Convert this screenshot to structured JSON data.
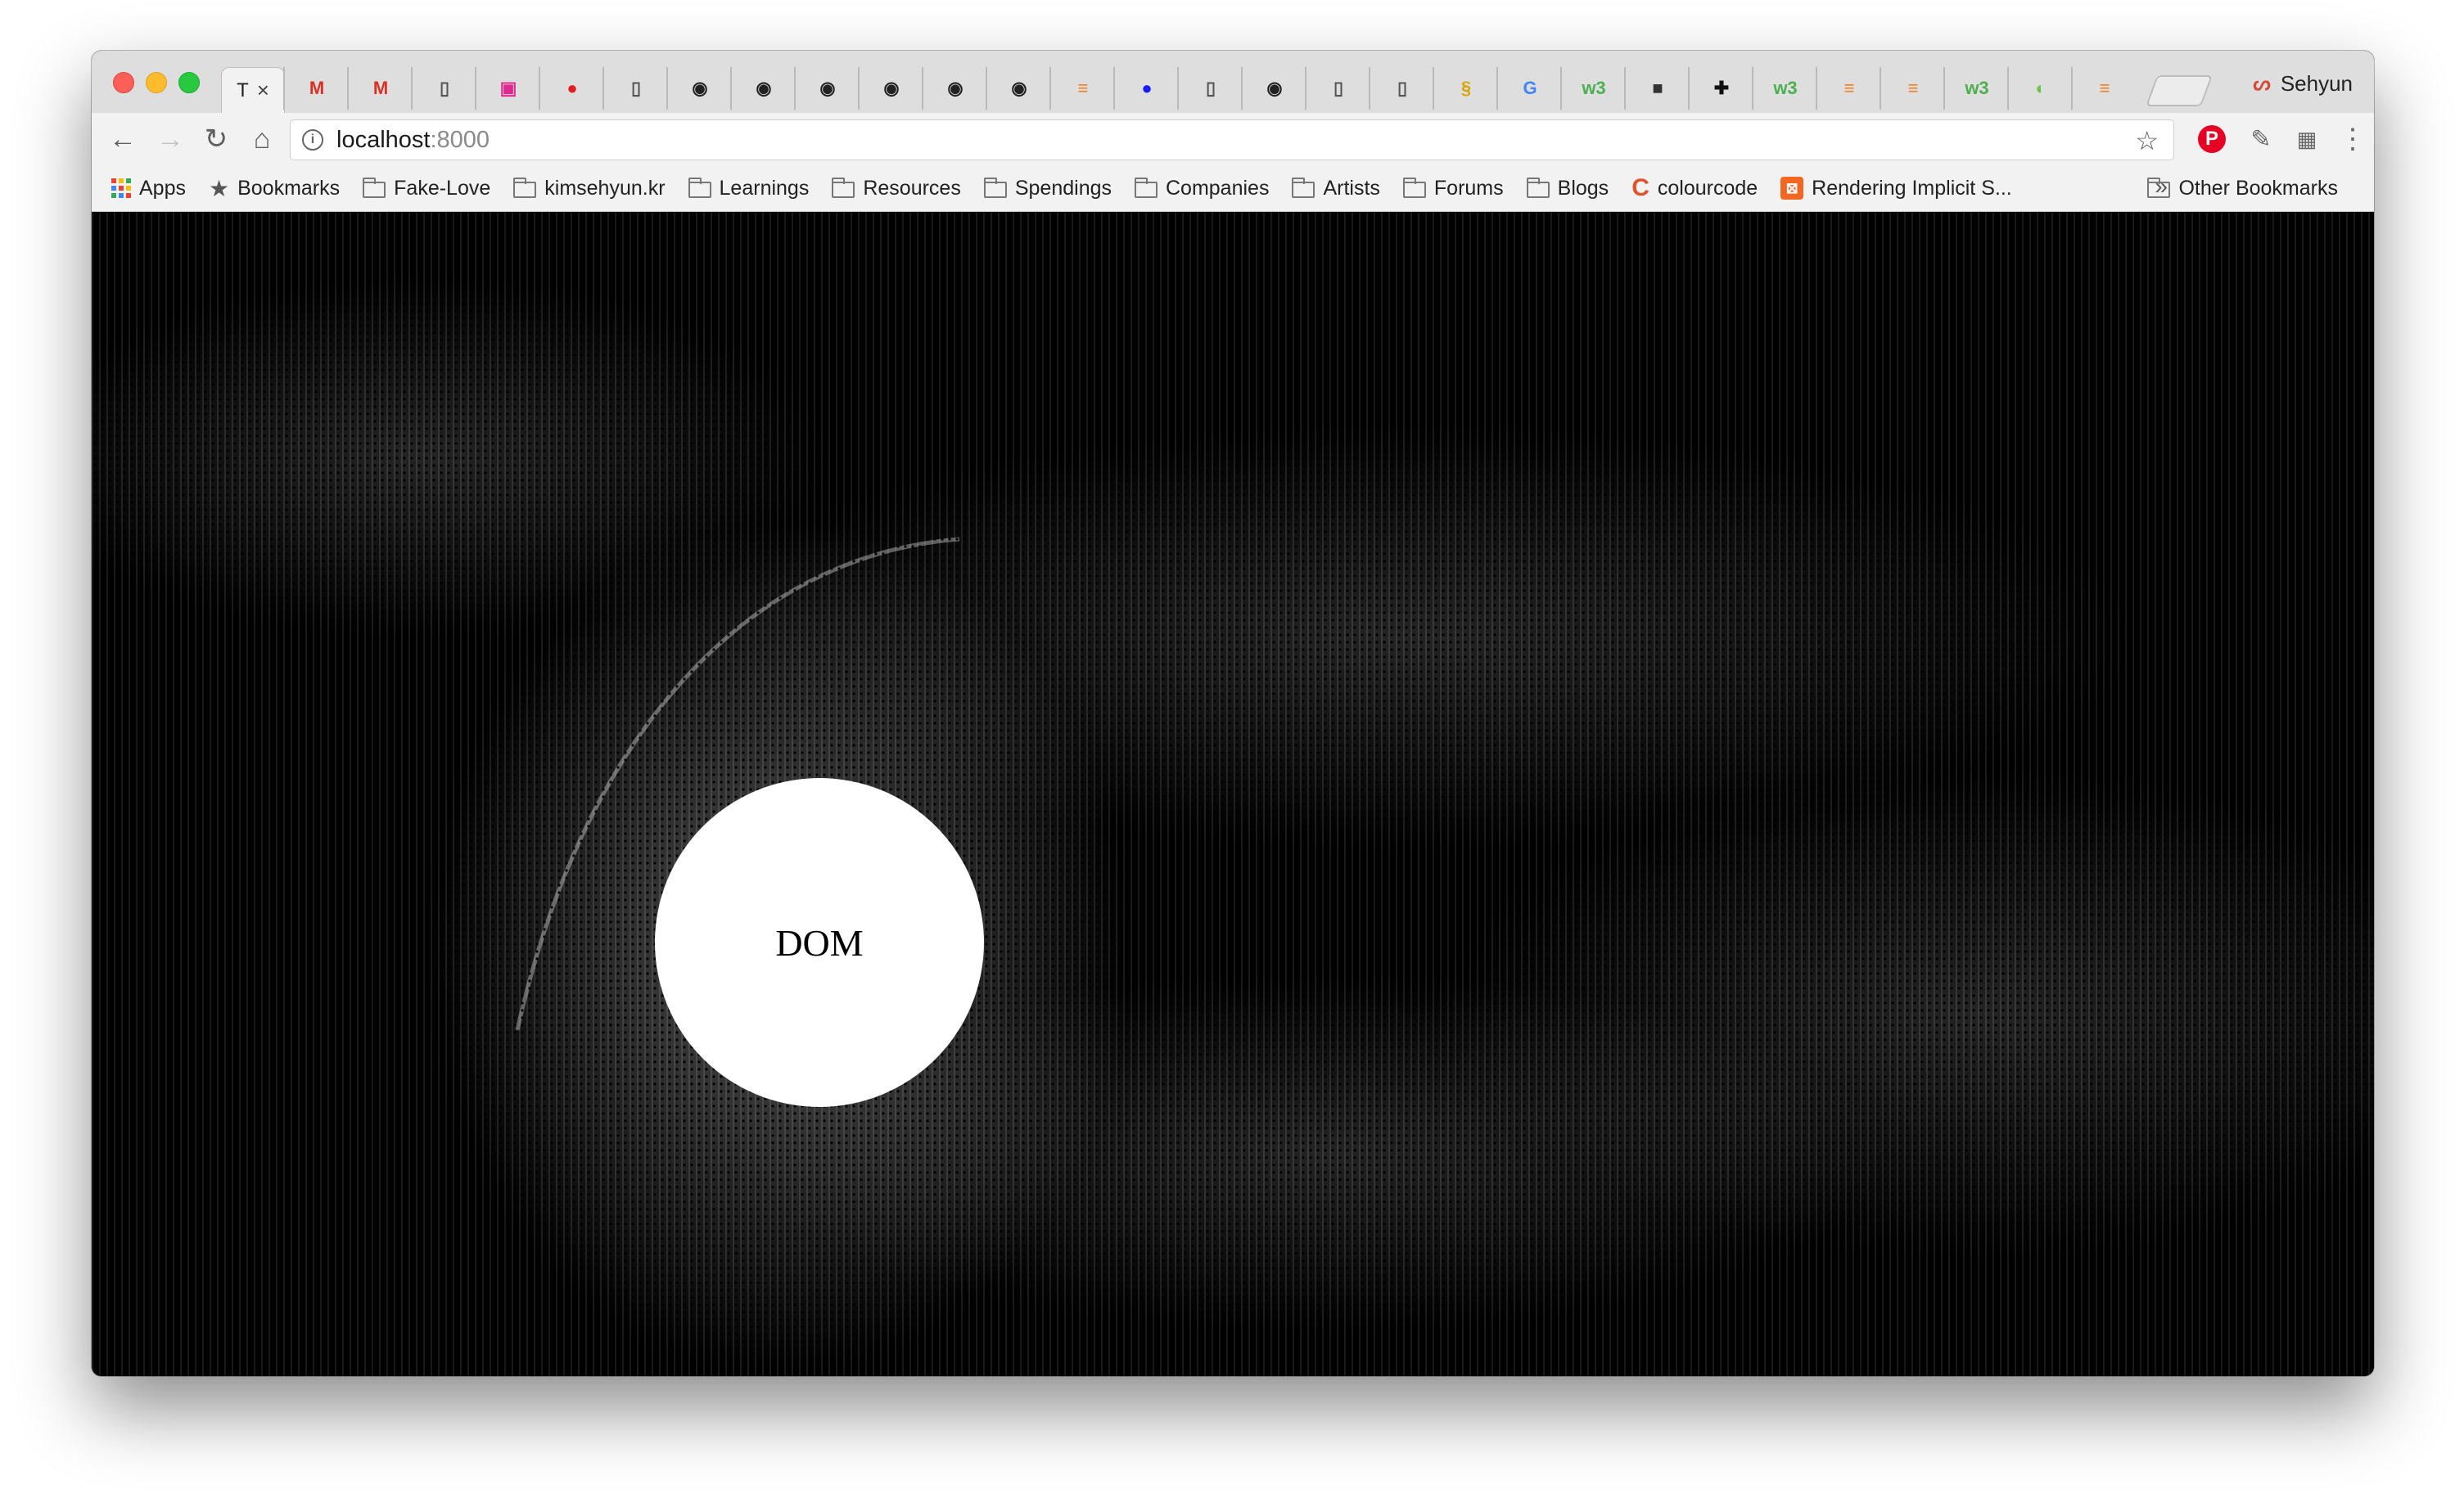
{
  "browser": {
    "active_tab": {
      "title": "T",
      "close": "×"
    },
    "tabs": [
      {
        "icon": "gmail-icon",
        "glyph": "M",
        "color": "#d93025"
      },
      {
        "icon": "gmail-icon",
        "glyph": "M",
        "color": "#d93025"
      },
      {
        "icon": "page-icon",
        "glyph": "▯",
        "color": "#555555"
      },
      {
        "icon": "chip-icon",
        "glyph": "▣",
        "color": "#e0298f"
      },
      {
        "icon": "leica-icon",
        "glyph": "●",
        "color": "#e02020"
      },
      {
        "icon": "page-icon",
        "glyph": "▯",
        "color": "#555555"
      },
      {
        "icon": "github-icon",
        "glyph": "◉",
        "color": "#222222"
      },
      {
        "icon": "github-icon",
        "glyph": "◉",
        "color": "#222222"
      },
      {
        "icon": "github-icon",
        "glyph": "◉",
        "color": "#222222"
      },
      {
        "icon": "github-icon",
        "glyph": "◉",
        "color": "#222222"
      },
      {
        "icon": "github-icon",
        "glyph": "◉",
        "color": "#222222"
      },
      {
        "icon": "github-icon",
        "glyph": "◉",
        "color": "#222222"
      },
      {
        "icon": "stackoverflow-icon",
        "glyph": "≡",
        "color": "#f48024"
      },
      {
        "icon": "blue-dot-icon",
        "glyph": "●",
        "color": "#1a1aff"
      },
      {
        "icon": "page-icon",
        "glyph": "▯",
        "color": "#555555"
      },
      {
        "icon": "github-icon",
        "glyph": "◉",
        "color": "#222222"
      },
      {
        "icon": "page-icon",
        "glyph": "▯",
        "color": "#555555"
      },
      {
        "icon": "page-icon",
        "glyph": "▯",
        "color": "#555555"
      },
      {
        "icon": "slides-icon",
        "glyph": "§",
        "color": "#d9a400"
      },
      {
        "icon": "google-icon",
        "glyph": "G",
        "color": "#4285f4"
      },
      {
        "icon": "w3schools-icon",
        "glyph": "w3",
        "color": "#4caf50"
      },
      {
        "icon": "g3d-icon",
        "glyph": "■",
        "color": "#333333"
      },
      {
        "icon": "plus-icon",
        "glyph": "✚",
        "color": "#111111"
      },
      {
        "icon": "w3schools-icon",
        "glyph": "w3",
        "color": "#4caf50"
      },
      {
        "icon": "stackoverflow-icon",
        "glyph": "≡",
        "color": "#f48024"
      },
      {
        "icon": "stackoverflow-icon",
        "glyph": "≡",
        "color": "#f48024"
      },
      {
        "icon": "w3schools-icon",
        "glyph": "w3",
        "color": "#4caf50"
      },
      {
        "icon": "leaf-icon",
        "glyph": "◐",
        "color": "#6cc24a"
      },
      {
        "icon": "stackoverflow-icon",
        "glyph": "≡",
        "color": "#f48024"
      }
    ],
    "profile_name": "Sehyun",
    "url_host": "localhost",
    "url_port": ":8000",
    "bookmarks": [
      {
        "label": "Apps",
        "icon": "apps-icon"
      },
      {
        "label": "Bookmarks",
        "icon": "star-icon"
      },
      {
        "label": "Fake-Love",
        "icon": "folder-icon"
      },
      {
        "label": "kimsehyun.kr",
        "icon": "folder-icon"
      },
      {
        "label": "Learnings",
        "icon": "folder-icon"
      },
      {
        "label": "Resources",
        "icon": "folder-icon"
      },
      {
        "label": "Spendings",
        "icon": "folder-icon"
      },
      {
        "label": "Companies",
        "icon": "folder-icon"
      },
      {
        "label": "Artists",
        "icon": "folder-icon"
      },
      {
        "label": "Forums",
        "icon": "folder-icon"
      },
      {
        "label": "Blogs",
        "icon": "folder-icon"
      },
      {
        "label": "colourcode",
        "icon": "colourcode-icon"
      },
      {
        "label": "Rendering Implicit S...",
        "icon": "rendering-icon"
      }
    ],
    "bookmarks_more": "»",
    "other_bookmarks": "Other Bookmarks"
  },
  "page": {
    "circle_label": "DOM"
  }
}
